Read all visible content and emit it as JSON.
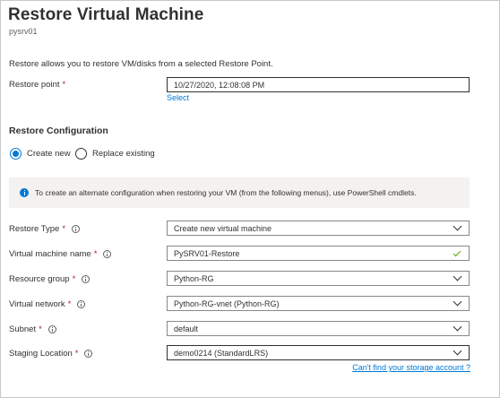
{
  "header": {
    "title": "Restore Virtual Machine",
    "subtitle": "pysrv01"
  },
  "description": "Restore allows you to restore VM/disks from a selected Restore Point.",
  "restore_point": {
    "label": "Restore point",
    "required": "*",
    "value": "10/27/2020, 12:08:08 PM",
    "select_link": "Select"
  },
  "restore_config": {
    "heading": "Restore Configuration",
    "options": [
      {
        "label": "Create new",
        "selected": true
      },
      {
        "label": "Replace existing",
        "selected": false
      }
    ],
    "info_message": "To create an alternate configuration when restoring your VM (from the following menus), use PowerShell cmdlets."
  },
  "form": {
    "restore_type": {
      "label": "Restore Type",
      "required": "*",
      "value": "Create new virtual machine",
      "icon": "chevron-down-icon"
    },
    "vm_name": {
      "label": "Virtual machine name",
      "required": "*",
      "value": "PySRV01-Restore",
      "icon": "checkmark-icon"
    },
    "resource_group": {
      "label": "Resource group",
      "required": "*",
      "value": "Python-RG",
      "icon": "chevron-down-icon"
    },
    "virtual_network": {
      "label": "Virtual network",
      "required": "*",
      "value": "Python-RG-vnet (Python-RG)",
      "icon": "chevron-down-icon"
    },
    "subnet": {
      "label": "Subnet",
      "required": "*",
      "value": "default",
      "icon": "chevron-down-icon"
    },
    "staging_location": {
      "label": "Staging Location",
      "required": "*",
      "value": "demo0214 (StandardLRS)",
      "icon": "chevron-down-icon"
    },
    "storage_link": "Can't find your storage account ?"
  },
  "colors": {
    "accent": "#0078d4",
    "required": "#a4262c",
    "valid": "#57a300",
    "info_background": "#f3f2f1"
  }
}
